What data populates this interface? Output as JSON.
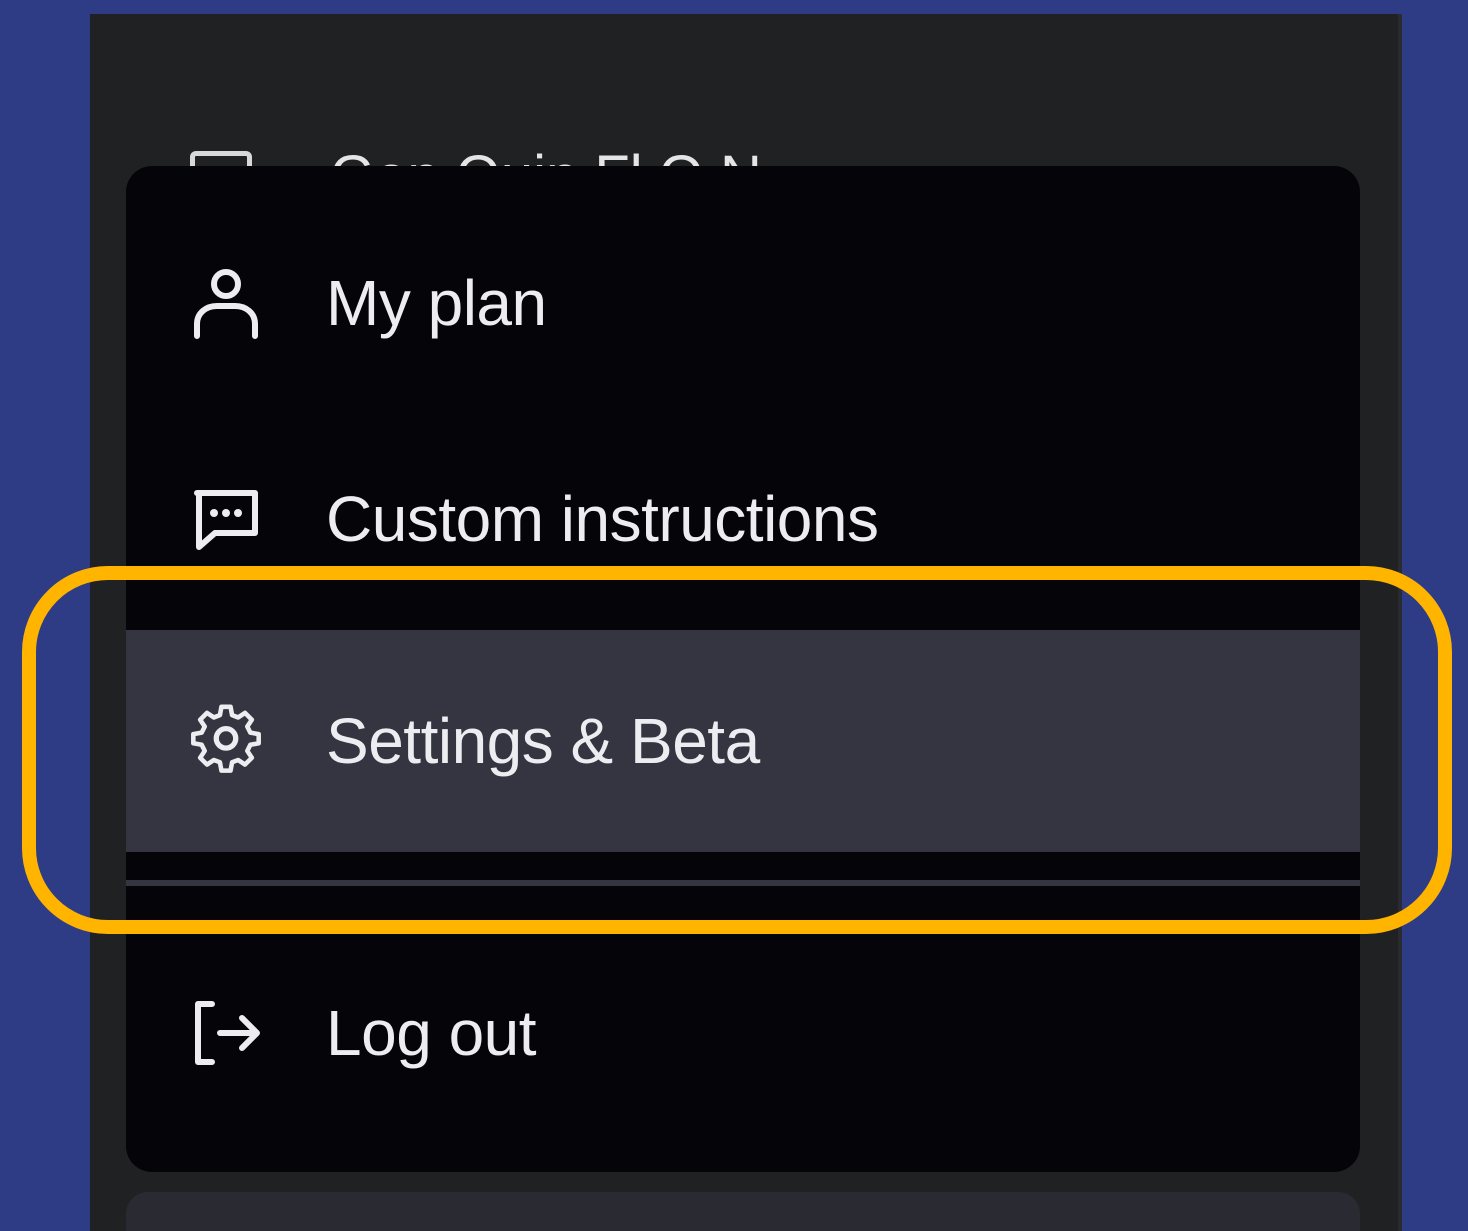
{
  "sidebar": {
    "obscured_item": {
      "icon": "chat-bubble-icon",
      "label": "Gen Ouin Fl O N"
    }
  },
  "menu": {
    "items": [
      {
        "label": "My plan",
        "icon": "user-icon"
      },
      {
        "label": "Custom instructions",
        "icon": "message-dots-icon"
      },
      {
        "label": "Settings & Beta",
        "icon": "gear-icon"
      },
      {
        "label": "Log out",
        "icon": "logout-icon"
      }
    ]
  },
  "colors": {
    "page_background": "#2e3c86",
    "sidebar_background": "#202123",
    "menu_background": "#050509",
    "selected_item_background": "#343541",
    "text": "#ececf1",
    "highlight_border": "#ffb400"
  }
}
